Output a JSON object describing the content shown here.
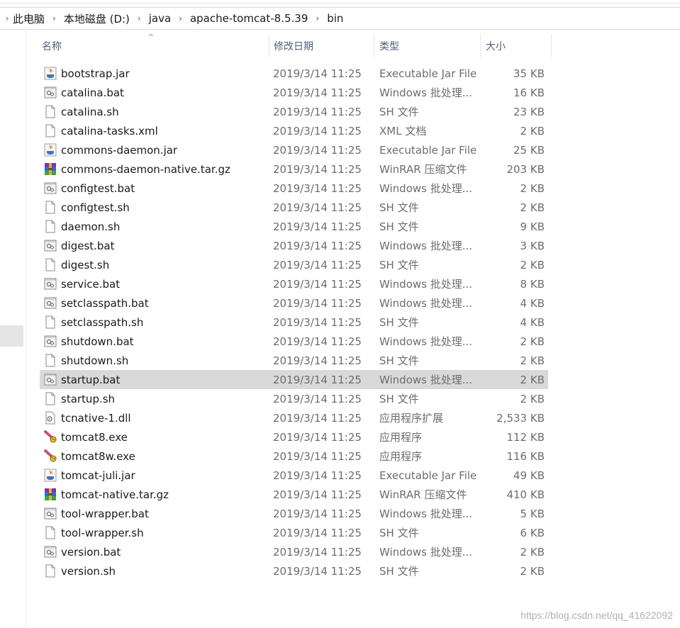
{
  "breadcrumb": [
    "此电脑",
    "本地磁盘 (D:)",
    "java",
    "apache-tomcat-8.5.39",
    "bin"
  ],
  "columns": {
    "name": "名称",
    "date": "修改日期",
    "type": "类型",
    "size": "大小"
  },
  "files": [
    {
      "name": "bootstrap.jar",
      "date": "2019/3/14 11:25",
      "type": "Executable Jar File",
      "size": "35 KB",
      "icon": "jar-icon"
    },
    {
      "name": "catalina.bat",
      "date": "2019/3/14 11:25",
      "type": "Windows 批处理...",
      "size": "16 KB",
      "icon": "bat-icon"
    },
    {
      "name": "catalina.sh",
      "date": "2019/3/14 11:25",
      "type": "SH 文件",
      "size": "23 KB",
      "icon": "file-icon"
    },
    {
      "name": "catalina-tasks.xml",
      "date": "2019/3/14 11:25",
      "type": "XML 文档",
      "size": "2 KB",
      "icon": "file-icon"
    },
    {
      "name": "commons-daemon.jar",
      "date": "2019/3/14 11:25",
      "type": "Executable Jar File",
      "size": "25 KB",
      "icon": "jar-icon"
    },
    {
      "name": "commons-daemon-native.tar.gz",
      "date": "2019/3/14 11:25",
      "type": "WinRAR 压缩文件",
      "size": "203 KB",
      "icon": "winrar-icon"
    },
    {
      "name": "configtest.bat",
      "date": "2019/3/14 11:25",
      "type": "Windows 批处理...",
      "size": "2 KB",
      "icon": "bat-icon"
    },
    {
      "name": "configtest.sh",
      "date": "2019/3/14 11:25",
      "type": "SH 文件",
      "size": "2 KB",
      "icon": "file-icon"
    },
    {
      "name": "daemon.sh",
      "date": "2019/3/14 11:25",
      "type": "SH 文件",
      "size": "9 KB",
      "icon": "file-icon"
    },
    {
      "name": "digest.bat",
      "date": "2019/3/14 11:25",
      "type": "Windows 批处理...",
      "size": "3 KB",
      "icon": "bat-icon"
    },
    {
      "name": "digest.sh",
      "date": "2019/3/14 11:25",
      "type": "SH 文件",
      "size": "2 KB",
      "icon": "file-icon"
    },
    {
      "name": "service.bat",
      "date": "2019/3/14 11:25",
      "type": "Windows 批处理...",
      "size": "8 KB",
      "icon": "bat-icon"
    },
    {
      "name": "setclasspath.bat",
      "date": "2019/3/14 11:25",
      "type": "Windows 批处理...",
      "size": "4 KB",
      "icon": "bat-icon"
    },
    {
      "name": "setclasspath.sh",
      "date": "2019/3/14 11:25",
      "type": "SH 文件",
      "size": "4 KB",
      "icon": "file-icon"
    },
    {
      "name": "shutdown.bat",
      "date": "2019/3/14 11:25",
      "type": "Windows 批处理...",
      "size": "2 KB",
      "icon": "bat-icon"
    },
    {
      "name": "shutdown.sh",
      "date": "2019/3/14 11:25",
      "type": "SH 文件",
      "size": "2 KB",
      "icon": "file-icon"
    },
    {
      "name": "startup.bat",
      "date": "2019/3/14 11:25",
      "type": "Windows 批处理...",
      "size": "2 KB",
      "icon": "bat-icon",
      "selected": true
    },
    {
      "name": "startup.sh",
      "date": "2019/3/14 11:25",
      "type": "SH 文件",
      "size": "2 KB",
      "icon": "file-icon"
    },
    {
      "name": "tcnative-1.dll",
      "date": "2019/3/14 11:25",
      "type": "应用程序扩展",
      "size": "2,533 KB",
      "icon": "dll-icon"
    },
    {
      "name": "tomcat8.exe",
      "date": "2019/3/14 11:25",
      "type": "应用程序",
      "size": "112 KB",
      "icon": "tomcat-icon"
    },
    {
      "name": "tomcat8w.exe",
      "date": "2019/3/14 11:25",
      "type": "应用程序",
      "size": "116 KB",
      "icon": "tomcat-icon"
    },
    {
      "name": "tomcat-juli.jar",
      "date": "2019/3/14 11:25",
      "type": "Executable Jar File",
      "size": "49 KB",
      "icon": "jar-icon"
    },
    {
      "name": "tomcat-native.tar.gz",
      "date": "2019/3/14 11:25",
      "type": "WinRAR 压缩文件",
      "size": "410 KB",
      "icon": "winrar-icon"
    },
    {
      "name": "tool-wrapper.bat",
      "date": "2019/3/14 11:25",
      "type": "Windows 批处理...",
      "size": "5 KB",
      "icon": "bat-icon"
    },
    {
      "name": "tool-wrapper.sh",
      "date": "2019/3/14 11:25",
      "type": "SH 文件",
      "size": "6 KB",
      "icon": "file-icon"
    },
    {
      "name": "version.bat",
      "date": "2019/3/14 11:25",
      "type": "Windows 批处理...",
      "size": "2 KB",
      "icon": "bat-icon"
    },
    {
      "name": "version.sh",
      "date": "2019/3/14 11:25",
      "type": "SH 文件",
      "size": "2 KB",
      "icon": "file-icon"
    }
  ],
  "watermark": "https://blog.csdn.net/qq_41622092",
  "colors": {
    "header_text": "#4c607a",
    "selected_row": "#d9d9d9",
    "secondary_text": "#6d6d6d"
  }
}
